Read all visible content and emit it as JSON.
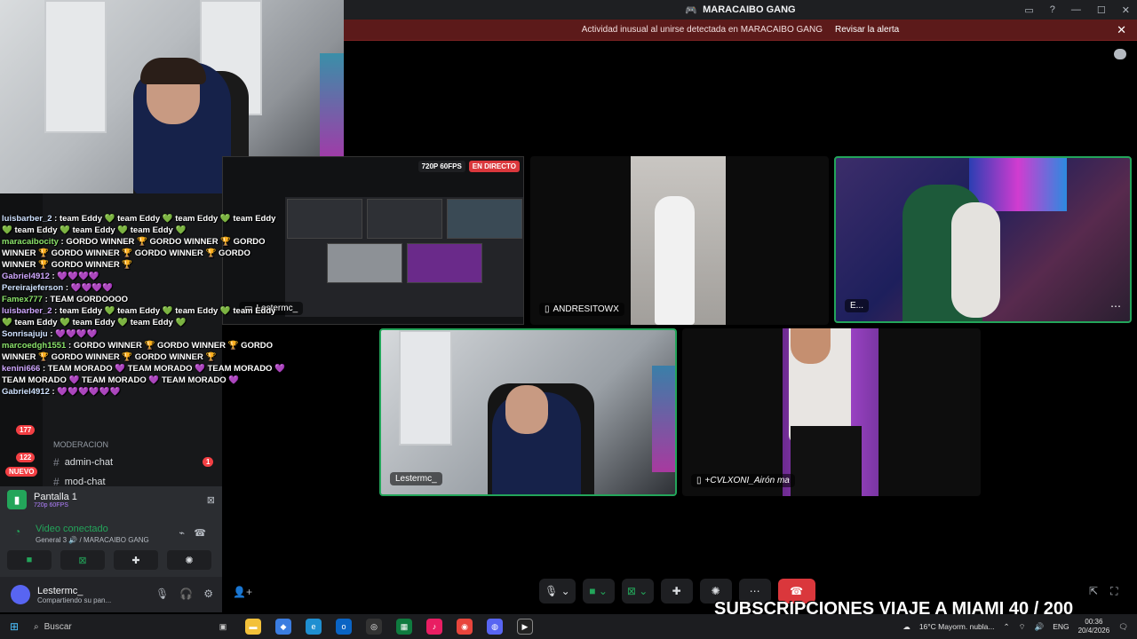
{
  "window": {
    "title": "MARACAIBO GANG",
    "alert_text": "Actividad inusual al unirse detectada en MARACAIBO GANG",
    "alert_link": "Revisar la alerta"
  },
  "screenshare": {
    "resolution": "720P 60FPS",
    "live": "EN DIRECTO",
    "user": "Lestermc_"
  },
  "tiles": {
    "andres": "ANDRESITOWX",
    "e": "E...",
    "lester": "Lestermc_",
    "cvl": "+CVLXONI_Airón ma"
  },
  "chat": [
    {
      "user": "luisbarber_2",
      "text": ": team Eddy 💚 team Eddy 💚 team Eddy 💚 team Eddy 💚 team Eddy 💚 team Eddy 💚 team Eddy 💚"
    },
    {
      "user": "maracaibocity",
      "text": ": GORDO WINNER 🏆 GORDO WINNER 🏆 GORDO WINNER 🏆 GORDO WINNER 🏆 GORDO WINNER 🏆 GORDO WINNER 🏆 GORDO WINNER 🏆"
    },
    {
      "user": "Gabriel4912",
      "text": ": 💜💜💜💜"
    },
    {
      "user": "Pereirajeferson",
      "text": ": 💜💜💜💜"
    },
    {
      "user": "Famex777",
      "text": ": TEAM GORDOOOO"
    },
    {
      "user": "luisbarber_2",
      "text": ": team Eddy 💚 team Eddy 💚 team Eddy 💚 team Eddy 💚 team Eddy 💚 team Eddy 💚 team Eddy 💚"
    },
    {
      "user": "Sonrisajuju",
      "text": ": 💜💜💜💜"
    },
    {
      "user": "marcoedgh1551",
      "text": ": GORDO WINNER 🏆 GORDO WINNER 🏆 GORDO WINNER 🏆 GORDO WINNER 🏆 GORDO WINNER 🏆"
    },
    {
      "user": "kenini666",
      "text": ": TEAM MORADO 💜 TEAM MORADO 💜 TEAM MORADO 💜 TEAM MORADO 💜 TEAM MORADO 💜 TEAM MORADO 💜"
    },
    {
      "user": "Gabriel4912",
      "text": ": 💜💜💜💜💜💜"
    }
  ],
  "sidebar": {
    "moderation_header": "MODERACION",
    "channel_admin": "admin-chat",
    "channel_mod": "mod-chat",
    "admin_badge": "1",
    "badge_177": "177",
    "badge_122": "122",
    "badge_new": "NUEVO"
  },
  "screen_panel": {
    "title": "Pantalla 1",
    "sub": "720p 60FPS"
  },
  "voice": {
    "status": "Video conectado",
    "location": "General 3 🔊 / MARACAIBO GANG"
  },
  "user": {
    "name": "Lestermc_",
    "status": "Compartiendo su pan..."
  },
  "overlay_text": "SUBSCRIPCIONES VIAJE A MIAMI 40 / 200",
  "taskbar": {
    "search": "Buscar",
    "weather": "16°C  Mayorm. nubla...",
    "lang": "ENG",
    "time": "00:36",
    "date": "20/4/2026"
  }
}
